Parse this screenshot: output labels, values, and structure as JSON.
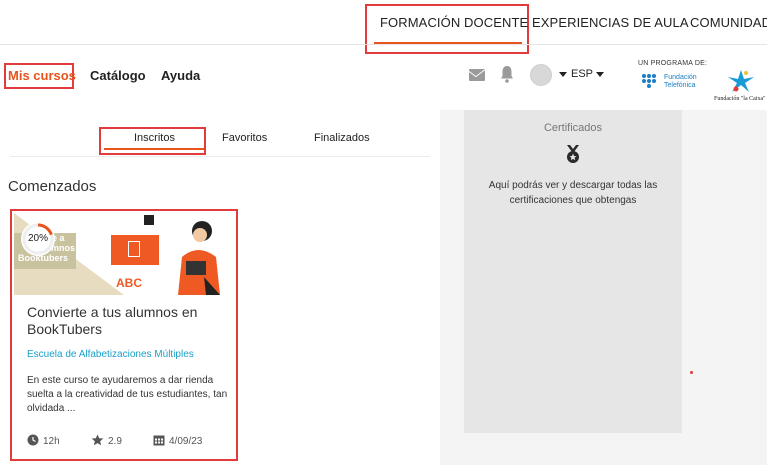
{
  "topnav": {
    "items": [
      "FORMACIÓN DOCENTE",
      "EXPERIENCIAS DE AULA",
      "COMUNIDAD"
    ]
  },
  "header": {
    "mis_cursos": "Mis cursos",
    "catalogo": "Catálogo",
    "ayuda": "Ayuda",
    "lang": "ESP",
    "programa": "UN PROGRAMA DE:",
    "fundacion_line1": "Fundación",
    "fundacion_line2": "Telefónica",
    "caixa": "Fundación \"la Caixa\""
  },
  "tabs": [
    "Inscritos",
    "Favoritos",
    "Finalizados"
  ],
  "section_title": "Comenzados",
  "course": {
    "progress": "20%",
    "progress_value": 0.2,
    "image_text_lines": [
      "ierte a",
      "alumnos en",
      "Booktubers"
    ],
    "image_abc": "ABC",
    "title": "Convierte a tus alumnos en BookTubers",
    "school": "Escuela de Alfabetizaciones Múltiples",
    "description": "En este curso te ayudaremos a dar rienda suelta a la creatividad de tus estudiantes, tan olvidada ...",
    "duration": "12h",
    "rating": "2.9",
    "date": "4/09/23"
  },
  "certificates": {
    "title": "Certificados",
    "text": "Aquí podrás ver y descargar todas las certificaciones que obtengas"
  },
  "colors": {
    "accent": "#e8531e",
    "highlight": "#e23b3b",
    "link": "#1ba0c9"
  }
}
